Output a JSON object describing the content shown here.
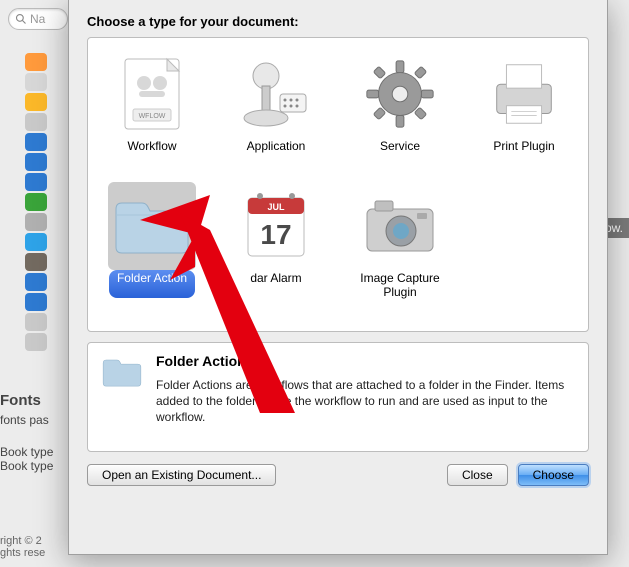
{
  "bg": {
    "search_placeholder": "Na",
    "fonts_heading": "Fonts",
    "fonts_line": "fonts pas",
    "book_line1": "Book type",
    "book_line2": "Book type",
    "right_line1": "right © 2",
    "right_line2": "ghts rese",
    "workflow_tag": "rkflow."
  },
  "dialog": {
    "title": "Choose a type for your document:",
    "types": [
      {
        "id": "workflow",
        "label": "Workflow",
        "selected": false
      },
      {
        "id": "application",
        "label": "Application",
        "selected": false
      },
      {
        "id": "service",
        "label": "Service",
        "selected": false
      },
      {
        "id": "print-plugin",
        "label": "Print Plugin",
        "selected": false
      },
      {
        "id": "folder-action",
        "label": "Folder Action",
        "selected": true
      },
      {
        "id": "calendar-alarm",
        "label": "dar Alarm",
        "selected": false
      },
      {
        "id": "image-capture-plugin",
        "label": "Image Capture Plugin",
        "selected": false
      }
    ],
    "description": {
      "heading": "Folder Action",
      "body": "Folder Actions are workflows that are attached to a folder in the Finder. Items added to the folder cause the workflow to run and are used as input to the workflow."
    },
    "buttons": {
      "open_existing": "Open an Existing Document...",
      "close": "Close",
      "choose": "Choose"
    }
  }
}
